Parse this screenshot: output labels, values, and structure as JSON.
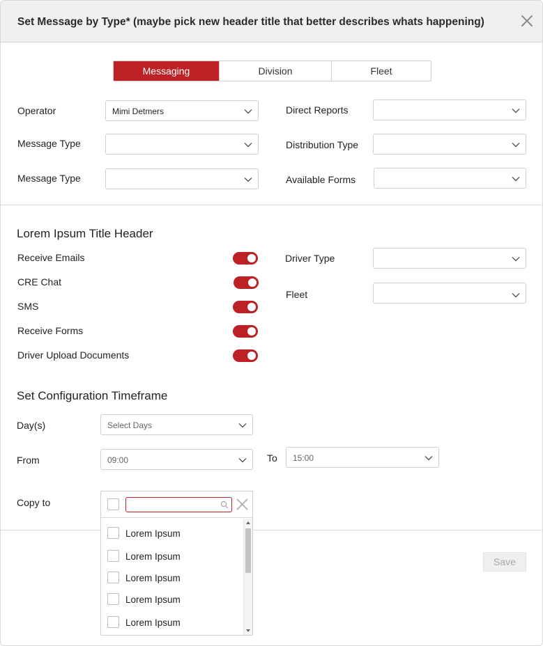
{
  "header": {
    "title": "Set Message by Type* (maybe pick new header title that better describes whats happening)"
  },
  "tabs": [
    {
      "label": "Messaging",
      "active": true
    },
    {
      "label": "Division",
      "active": false
    },
    {
      "label": "Fleet",
      "active": false
    }
  ],
  "form": {
    "operator": {
      "label": "Operator",
      "value": "Mimi Detmers"
    },
    "message_type_1": {
      "label": "Message Type",
      "value": ""
    },
    "message_type_2": {
      "label": "Message Type",
      "value": ""
    },
    "direct_reports": {
      "label": "Direct Reports",
      "value": ""
    },
    "distribution_type": {
      "label": "Distribution Type",
      "value": ""
    },
    "available_forms": {
      "label": "Available Forms",
      "value": ""
    }
  },
  "section1": {
    "title": "Lorem Ipsum Title Header",
    "toggles": [
      {
        "label": "Receive Emails",
        "on": true
      },
      {
        "label": "CRE Chat",
        "on": true
      },
      {
        "label": "SMS",
        "on": true
      },
      {
        "label": "Receive Forms",
        "on": true
      },
      {
        "label": "Driver Upload Documents",
        "on": true
      }
    ],
    "driver_type": {
      "label": "Driver Type",
      "value": ""
    },
    "fleet": {
      "label": "Fleet",
      "value": ""
    }
  },
  "timeframe": {
    "title": "Set Configuration Timeframe",
    "days": {
      "label": "Day(s)",
      "placeholder": "Select Days"
    },
    "from": {
      "label": "From",
      "value": "09:00"
    },
    "to": {
      "label": "To",
      "value": "15:00"
    },
    "copy_to": {
      "label": "Copy to",
      "search_value": "",
      "items": [
        "Lorem Ipsum",
        "Lorem Ipsum",
        "Lorem Ipsum",
        "Lorem Ipsum",
        "Lorem Ipsum"
      ]
    }
  },
  "footer": {
    "save_label": "Save"
  },
  "colors": {
    "accent": "#bd2126",
    "border": "#cfcfcf",
    "header_bg": "#f0f0f0",
    "disabled_text": "#a8a8a8"
  },
  "icons": {
    "close": "close-icon",
    "chevron": "chevron-down-icon",
    "search": "search-icon",
    "clear": "clear-icon"
  }
}
